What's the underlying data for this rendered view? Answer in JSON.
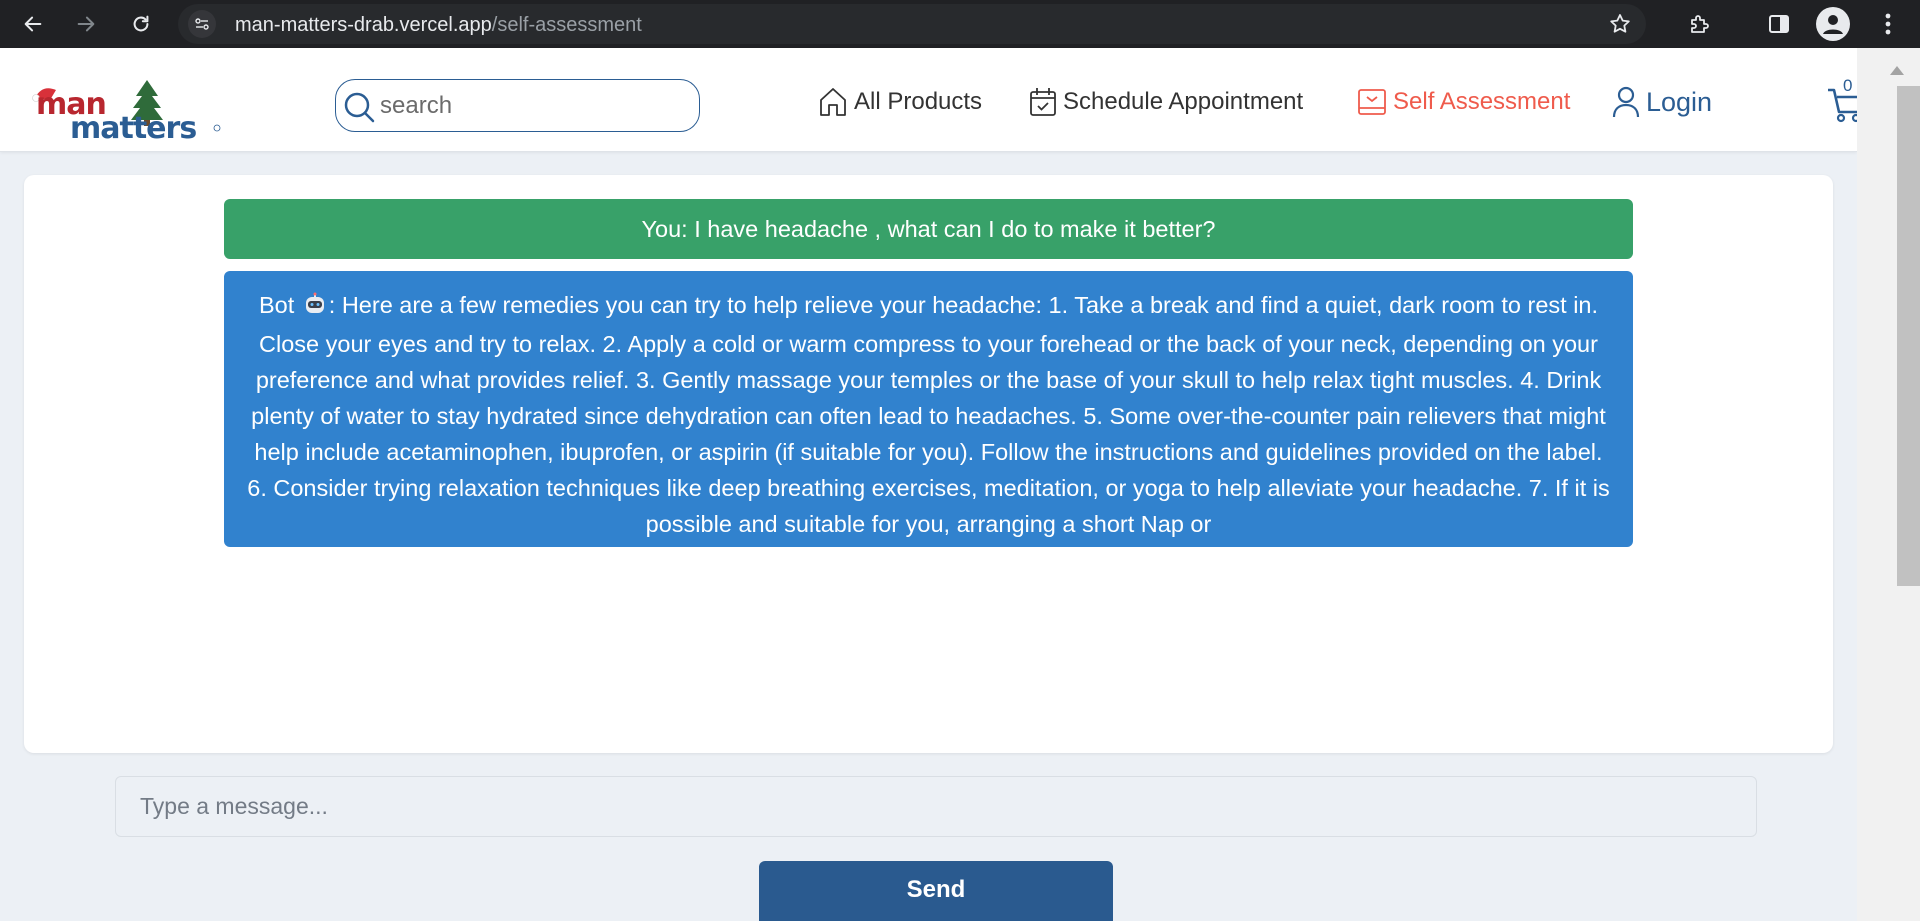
{
  "browser": {
    "url_domain": "man-matters-drab.vercel.app",
    "url_path": "/self-assessment",
    "icons": [
      "back-icon",
      "forward-icon",
      "reload-icon",
      "site-info-icon",
      "bookmark-star-icon",
      "extensions-icon",
      "side-panel-icon",
      "profile-icon",
      "menu-dots-icon"
    ]
  },
  "header": {
    "logo_text_top": "man",
    "logo_text_bottom": "matters",
    "search_placeholder": "search",
    "nav": {
      "products": "All Products",
      "schedule": "Schedule Appointment",
      "self_assessment": "Self Assessment",
      "login": "Login"
    },
    "cart_count": "0",
    "colors": {
      "brand_blue": "#2b5d93",
      "active_red": "#ef5b4c"
    }
  },
  "chat": {
    "messages": [
      {
        "sender": "user",
        "text": "You: I have headache , what can I do to make it better?",
        "color": "#38a169"
      },
      {
        "sender": "bot",
        "prefix": "Bot",
        "emoji": "robot-icon",
        "text": ": Here are a few remedies you can try to help relieve your headache: 1. Take a break and find a quiet, dark room to rest in. Close your eyes and try to relax. 2. Apply a cold or warm compress to your forehead or the back of your neck, depending on your preference and what provides relief. 3. Gently massage your temples or the base of your skull to help relax tight muscles. 4. Drink plenty of water to stay hydrated since dehydration can often lead to headaches. 5. Some over-the-counter pain relievers that might help include acetaminophen, ibuprofen, or aspirin (if suitable for you). Follow the instructions and guidelines provided on the label. 6. Consider trying relaxation techniques like deep breathing exercises, meditation, or yoga to help alleviate your headache. 7. If it is possible and suitable for you, arranging a short Nap or",
        "color": "#3182ce"
      }
    ],
    "input_placeholder": "Type a message...",
    "send_label": "Send"
  }
}
